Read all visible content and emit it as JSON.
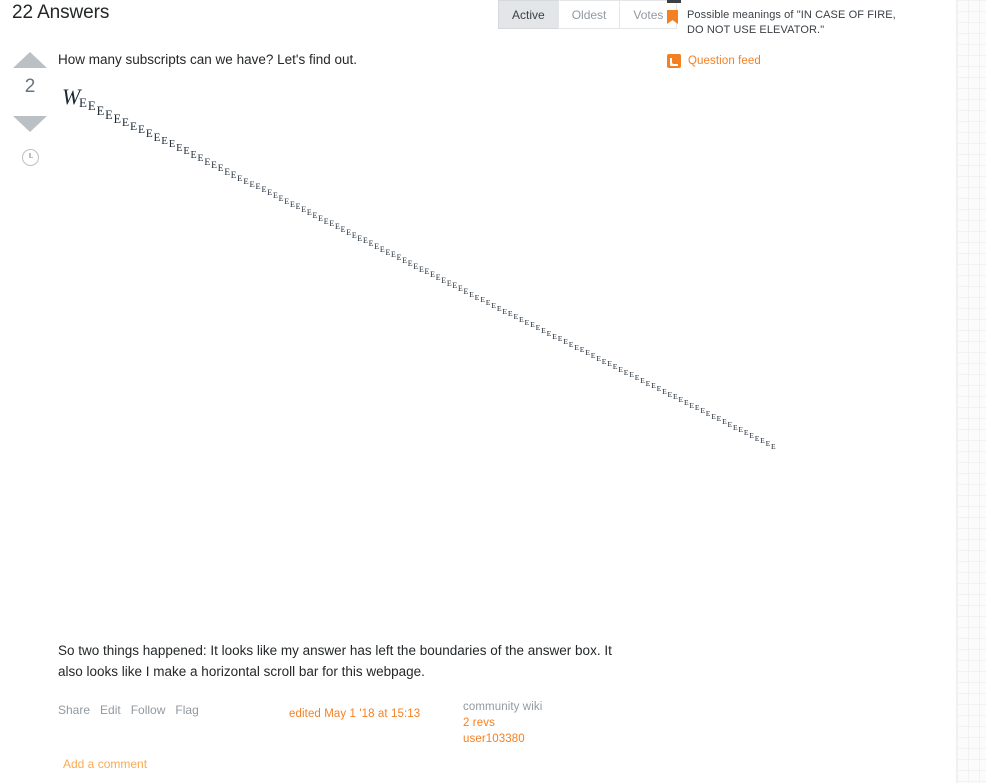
{
  "header": {
    "answers_count_label": "22 Answers",
    "sort_tabs": [
      {
        "label": "Active",
        "selected": true
      },
      {
        "label": "Oldest",
        "selected": false
      },
      {
        "label": "Votes",
        "selected": false
      }
    ]
  },
  "sidebar": {
    "hot_question_text": "Possible meanings of \"IN CASE OF FIRE, DO NOT USE ELEVATOR.\"",
    "question_feed_label": "Question feed",
    "bookmark_icon": "bookmark-icon",
    "rss_icon": "rss-icon"
  },
  "answer": {
    "vote": {
      "up_icon": "vote-up-arrow-icon",
      "score": "2",
      "down_icon": "vote-down-arrow-icon",
      "history_icon": "history-clock-icon"
    },
    "intro_text": "How many subscripts can we have? Let's find out.",
    "formula": {
      "base": "W",
      "subscript_char": "E",
      "subscript_count": 118
    },
    "outro_text": "So two things happened: It looks like my answer has left the boundaries of the answer box. It also looks like I make a horizontal scroll bar for this webpage.",
    "footer": {
      "menu": [
        "Share",
        "Edit",
        "Follow",
        "Flag"
      ],
      "edited_stamp": "edited May 1 '18 at 15:13",
      "community_wiki": "community wiki",
      "revisions": "2 revs",
      "user": "user103380"
    },
    "add_comment_label": "Add a comment"
  },
  "colors": {
    "accent_orange": "#f48024",
    "muted_gray": "#9199a1",
    "text_dark": "#242729",
    "tab_selected_bg": "#e3e6e8"
  }
}
